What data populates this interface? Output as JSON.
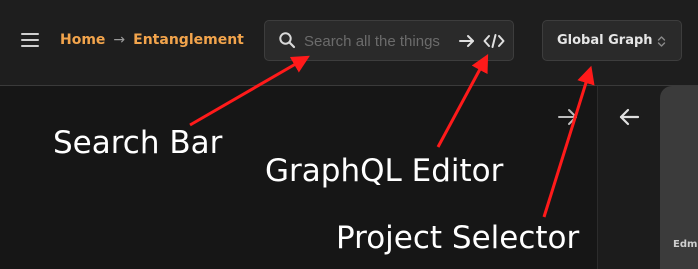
{
  "header": {
    "breadcrumb": {
      "home": "Home",
      "separator": "→",
      "current": "Entanglement"
    },
    "search": {
      "placeholder": "Search all the things"
    },
    "project_selector": {
      "label": "Global Graph"
    }
  },
  "side_panel": {
    "map_label": "Edm"
  },
  "annotations": {
    "search_bar": "Search Bar",
    "graphql_editor": "GraphQL Editor",
    "project_selector": "Project Selector",
    "arrow_color": "#ff1a1a"
  },
  "colors": {
    "accent": "#f2a44c",
    "background": "#1b1b1b",
    "panel": "#161616"
  }
}
